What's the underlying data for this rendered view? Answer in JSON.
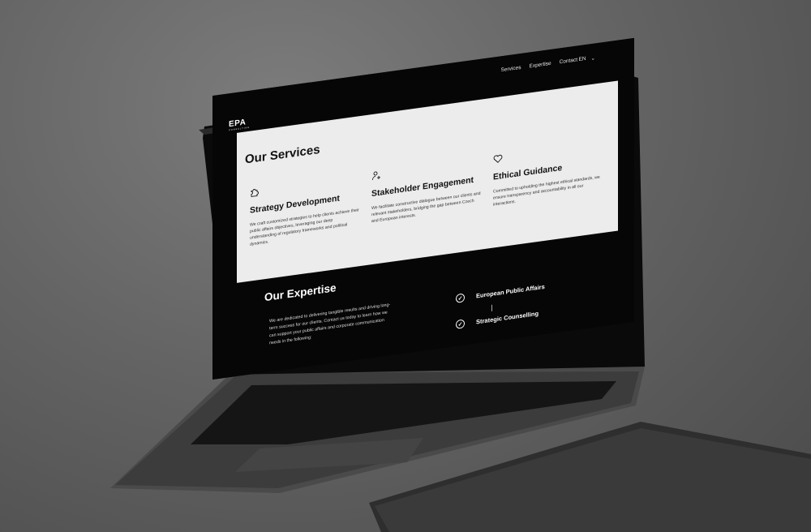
{
  "nav": {
    "links": [
      "Services",
      "Expertise",
      "Contact"
    ],
    "language": "EN"
  },
  "logo": {
    "text": "EPA",
    "subtext": "CONSULTING"
  },
  "services": {
    "title": "Our Services",
    "cards": [
      {
        "icon": "puzzle-icon",
        "title": "Strategy Development",
        "text": "We craft customized strategies to help clients achieve their public affairs objectives, leveraging our deep understanding of regulatory frameworks and political dynamics."
      },
      {
        "icon": "user-plus-icon",
        "title": "Stakeholder Engagement",
        "text": "We facilitate constructive dialogue between our clients and relevant stakeholders, bridging the gap between Czech and European interests."
      },
      {
        "icon": "heart-icon",
        "title": "Ethical Guidance",
        "text": "Committed to upholding the highest ethical standards, we ensure transparency and accountability in all our interactions."
      }
    ]
  },
  "expertise": {
    "title": "Our Expertise",
    "text": "We are dedicated to delivering tangible results and driving long-term success for our clients. Contact us today to learn how we can support your public affairs and corporate communication needs in the following:",
    "items": [
      "European Public Affairs",
      "Strategic Counselling"
    ]
  }
}
